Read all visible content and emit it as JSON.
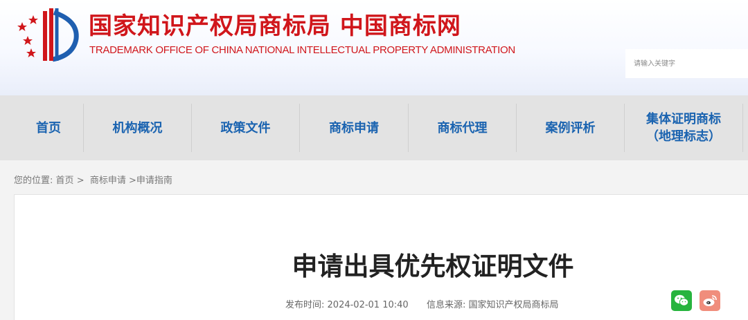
{
  "header": {
    "title": "国家知识产权局商标局 中国商标网",
    "subtitle": "TRADEMARK OFFICE OF CHINA NATIONAL INTELLECTUAL PROPERTY ADMINISTRATION",
    "search_placeholder": "请输入关键字"
  },
  "nav": {
    "items": [
      {
        "label": "首页"
      },
      {
        "label": "机构概况"
      },
      {
        "label": "政策文件"
      },
      {
        "label": "商标申请"
      },
      {
        "label": "商标代理"
      },
      {
        "label": "案例评析"
      },
      {
        "label_line1": "集体证明商标",
        "label_line2": "（地理标志）"
      }
    ]
  },
  "breadcrumb": {
    "prefix": "您的位置:",
    "items": [
      "首页",
      "商标申请",
      "申请指南"
    ],
    "separator": ">"
  },
  "article": {
    "title": "申请出具优先权证明文件",
    "publish_label": "发布时间:",
    "publish_time": "2024-02-01 10:40",
    "source_label": "信息来源:",
    "source": "国家知识产权局商标局"
  },
  "share": {
    "icons": [
      "wechat-icon",
      "weibo-icon"
    ],
    "colors": {
      "wechat": "#27b43e",
      "weibo": "#f08d7c"
    }
  },
  "colors": {
    "brand_red": "#d0161b",
    "nav_blue": "#1a63b0",
    "nav_bg": "#e3e3e3"
  }
}
